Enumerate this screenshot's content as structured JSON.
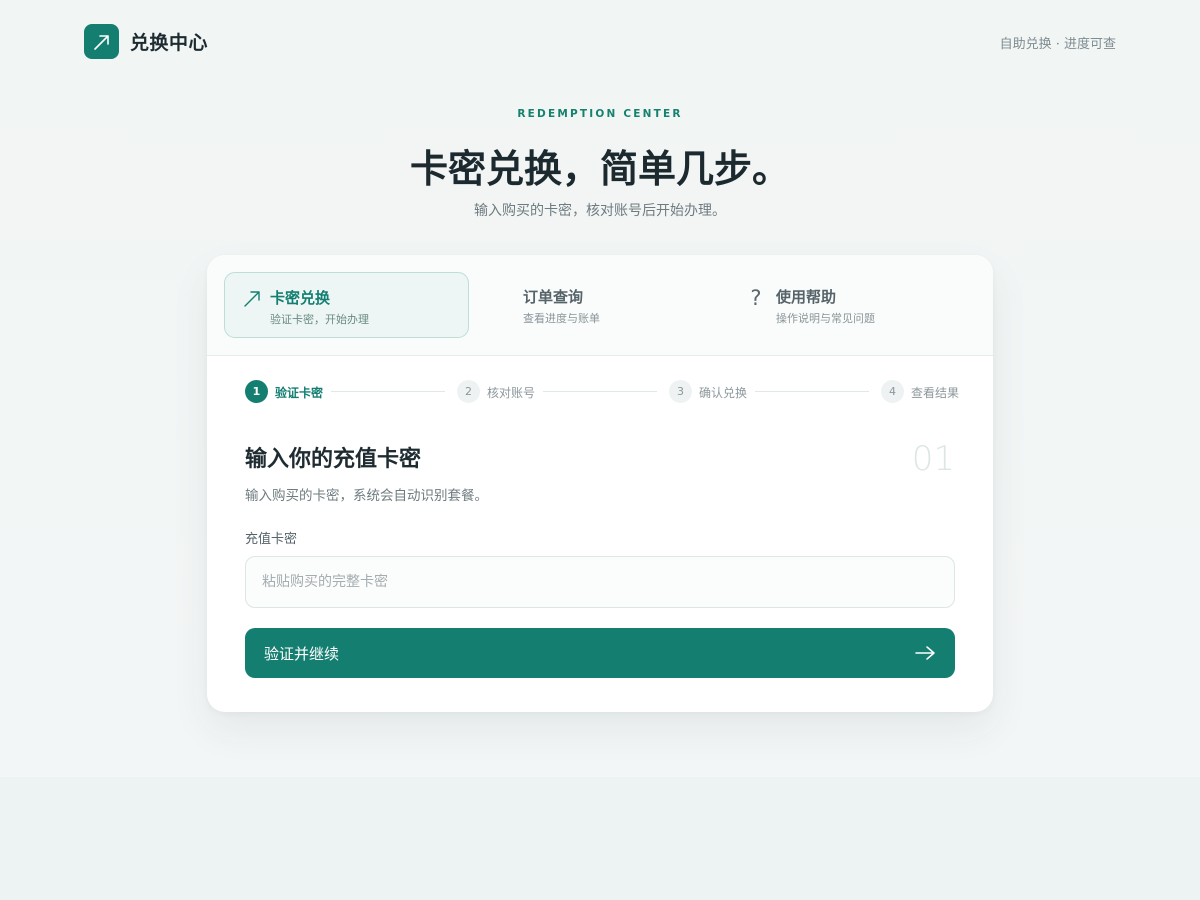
{
  "header": {
    "brand_name": "兑换中心",
    "logo_icon": "arrow-up-right-icon",
    "tagline": "自助兑换 · 进度可查"
  },
  "hero": {
    "eyebrow": "REDEMPTION CENTER",
    "title": "卡密兑换，简单几步。",
    "subtitle": "输入购买的卡密，核对账号后开始办理。"
  },
  "tabs": [
    {
      "title": "卡密兑换",
      "desc": "验证卡密，开始办理",
      "icon": "arrow-up-right-icon",
      "active": true
    },
    {
      "title": "订单查询",
      "desc": "查看进度与账单",
      "icon": "",
      "active": false
    },
    {
      "title": "使用帮助",
      "desc": "操作说明与常见问题",
      "icon": "question-mark-icon",
      "active": false
    }
  ],
  "steps": [
    {
      "num": "1",
      "label": "验证卡密",
      "active": true
    },
    {
      "num": "2",
      "label": "核对账号",
      "active": false
    },
    {
      "num": "3",
      "label": "确认兑换",
      "active": false
    },
    {
      "num": "4",
      "label": "查看结果",
      "active": false
    }
  ],
  "form": {
    "title": "输入你的充值卡密",
    "step_index": "01",
    "description": "输入购买的卡密，系统会自动识别套餐。",
    "field_label": "充值卡密",
    "input_value": "",
    "input_placeholder": "粘贴购买的完整卡密",
    "submit_label": "验证并继续",
    "submit_icon": "arrow-right-icon"
  },
  "colors": {
    "accent": "#147f71",
    "background": "#f1f5f4",
    "card": "#ffffff",
    "text_primary": "#1c2a30",
    "text_muted": "#6f7b80"
  }
}
